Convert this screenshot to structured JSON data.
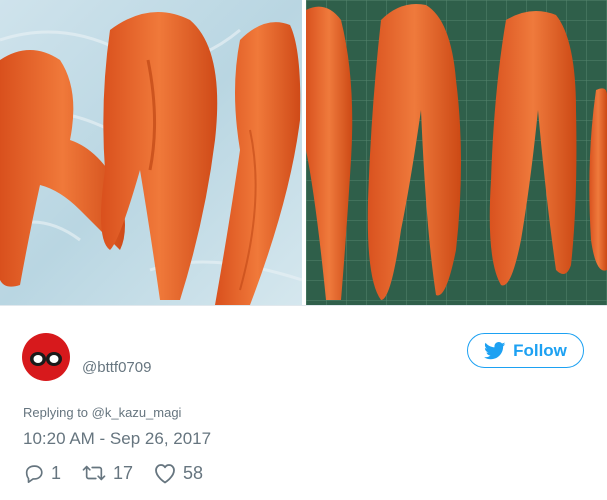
{
  "tweet": {
    "username": "@bttf0709",
    "follow_label": "Follow",
    "reply_prefix": "Replying to ",
    "reply_to": "@k_kazu_magi",
    "timestamp": "10:20 AM - Sep 26, 2017",
    "reply_count": "1",
    "retweet_count": "17",
    "like_count": "58"
  },
  "colors": {
    "accent": "#1da1f2",
    "muted_text": "#66757f",
    "avatar": "#d7191c",
    "carrot": "#e8632a"
  },
  "icons": {
    "follow": "twitter-bird-icon",
    "reply": "reply-icon",
    "retweet": "retweet-icon",
    "like": "heart-icon"
  }
}
